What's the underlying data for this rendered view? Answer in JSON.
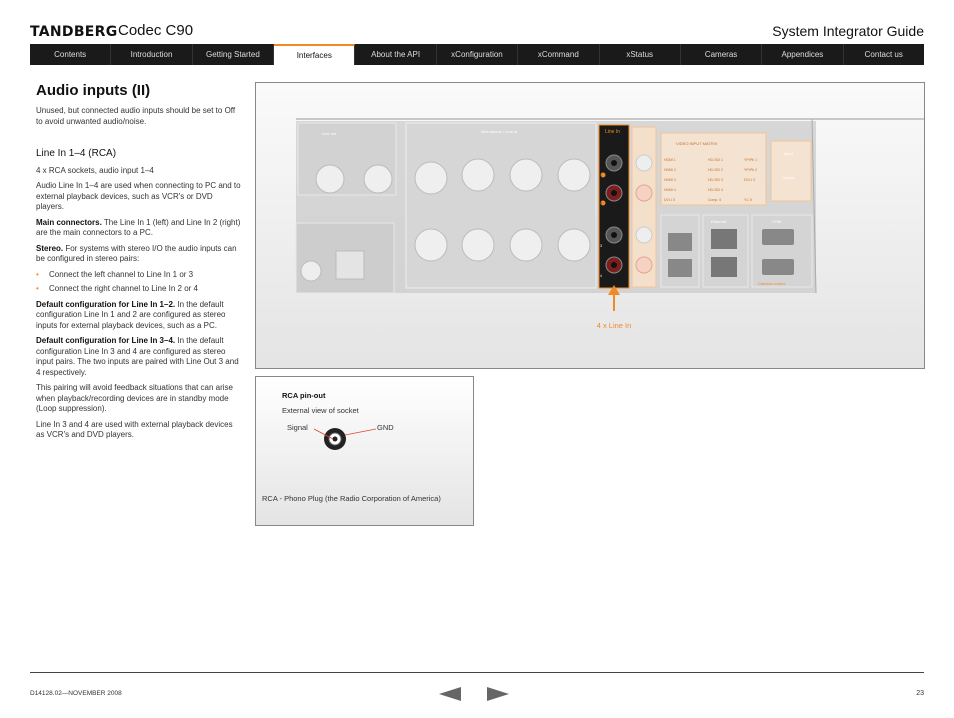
{
  "header": {
    "brand": "TANDBERG",
    "product": "Codec C90",
    "guide": "System Integrator Guide"
  },
  "nav": [
    {
      "label": "Contents"
    },
    {
      "label": "Introduction"
    },
    {
      "label": "Getting Started"
    },
    {
      "label": "Interfaces",
      "active": true
    },
    {
      "label": "About the API"
    },
    {
      "label": "xConfiguration"
    },
    {
      "label": "xCommand"
    },
    {
      "label": "xStatus"
    },
    {
      "label": "Cameras"
    },
    {
      "label": "Appendices"
    },
    {
      "label": "Contact us"
    }
  ],
  "main": {
    "title": "Audio inputs (II)",
    "intro": "Unused, but connected audio inputs should be set to Off to avoid unwanted audio/noise.",
    "section_title": "Line In 1–4 (RCA)",
    "p1": "4 x RCA sockets, audio input 1–4",
    "p2": "Audio Line In 1–4 are used when connecting to PC and to  external playback devices, such as VCR's or DVD players.",
    "p3_bold": "Main connectors.",
    "p3": " The Line In 1 (left) and Line In 2 (right) are the main connectors to a PC.",
    "p4_bold": "Stereo.",
    "p4": " For systems with stereo I/O the audio inputs can be configured in stereo pairs:",
    "bullets": [
      "Connect the left channel to Line In 1 or 3",
      "Connect the right channel to Line In 2 or 4"
    ],
    "p5_bold": "Default configuration for Line In 1–2.",
    "p5": " In the default configuration Line In 1 and 2 are configured as stereo inputs for external playback devices, such as a PC.",
    "p6_bold": "Default configuration for Line In 3–4.",
    "p6": " In the default configuration Line In 3 and 4 are configured as stereo input pairs. The two inputs are paired with Line Out 3 and 4 respectively.",
    "p7": "This pairing will avoid feedback situations that can arise when playback/recording devices are in standby mode (Loop suppression).",
    "p8": "Line In 3 and 4 are used with external playback devices as VCR's and DVD players."
  },
  "figure": {
    "callout": "4 x Line In",
    "panel_label": "Line In",
    "jack_labels": [
      "1",
      "2",
      "3",
      "4"
    ],
    "device_labels": {
      "line_out": "Line out",
      "mic_in": "Microphone / Line in",
      "video_table": "VIDEO INPUT MATRIX",
      "output": "Output",
      "input": "Input",
      "ethernet": "Ethernet",
      "com": "COM",
      "camera_control": "Camera control"
    },
    "matrix_rows": [
      [
        "HDMI 1",
        "HD-SDI 1",
        "YPrPb 1"
      ],
      [
        "HDMI 2",
        "HD-SDI 2",
        "YPrPb 2"
      ],
      [
        "HDMI 3",
        "HD-SDI 3",
        "DVI-I 3"
      ],
      [
        "HDMI 4",
        "HD-SDI 4",
        ""
      ],
      [
        "DVI-I 5",
        "Comp. 5",
        "YC 5"
      ]
    ]
  },
  "rca": {
    "title": "RCA pin-out",
    "subtitle": "External view of socket",
    "signal": "Signal",
    "gnd": "GND",
    "caption": "RCA - Phono Plug (the Radio Corporation of America)"
  },
  "footer": {
    "doc_id": "D14128.02—NOVEMBER 2008",
    "page": "23"
  },
  "colors": {
    "accent": "#f08a24",
    "nav_bg": "#1a1a1a"
  }
}
